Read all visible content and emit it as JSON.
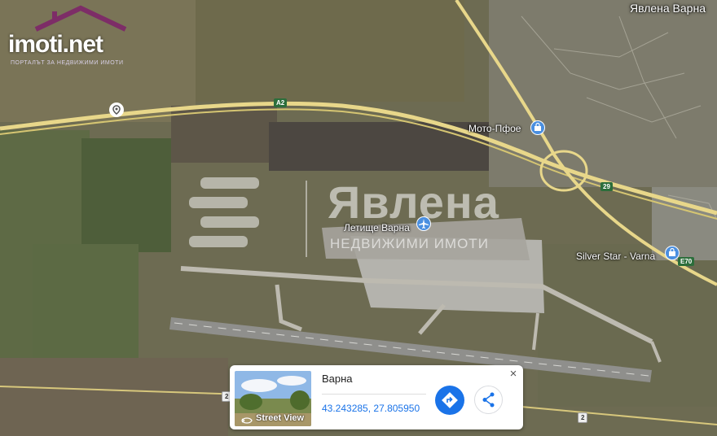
{
  "corner_label": "Явлена Варна",
  "logo": {
    "text": "imoti.net",
    "subtitle": "ПОРТАЛЪТ ЗА НЕДВИЖИМИ ИМОТИ"
  },
  "watermark": {
    "title": "Явлена",
    "subtitle": "НЕДВИЖИМИ ИМОТИ"
  },
  "map_labels": {
    "moto_pfoe": "Мото-Пфое",
    "airport": "Летище Варна",
    "silver_star": "Silver Star - Varna"
  },
  "road_shields": {
    "a2": "A2",
    "e70": "E70",
    "road29": "29",
    "road2_left": "2",
    "road2_right": "2"
  },
  "info_card": {
    "place_name": "Варна",
    "coordinates": "43.243285, 27.805950",
    "street_view_label": "Street View",
    "close_symbol": "×"
  },
  "icons": {
    "place_pin": "map-pin-icon",
    "store": "shopping-bag-icon",
    "airport": "airplane-icon",
    "directions": "directions-icon",
    "share": "share-icon",
    "close": "close-icon",
    "street_view": "street-view-icon"
  },
  "colors": {
    "highway": "#e8d78a",
    "poi_blue": "#4a8fe0",
    "link_blue": "#1a73e8",
    "logo_purple": "#7d2d67"
  }
}
